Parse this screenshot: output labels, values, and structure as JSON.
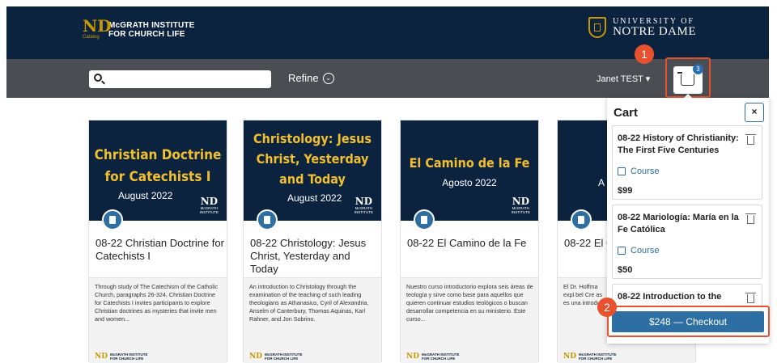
{
  "header": {
    "brand_line1": "McGRATH INSTITUTE",
    "brand_line2": "FOR CHURCH LIFE",
    "brand_catalog": "Catalog",
    "university_line1": "UNIVERSITY OF",
    "university_line2": "NOTRE DAME"
  },
  "nav": {
    "search_placeholder": "",
    "refine_label": "Refine",
    "user_label": "Janet TEST ▾",
    "cart_count": "3"
  },
  "callouts": [
    "1",
    "2"
  ],
  "cards": [
    {
      "banner_title": "Christian Doctrine for Catechists I",
      "banner_date": "August 2022",
      "title": "08-22 Christian Doctrine for Catechists I",
      "description": "Through study of The Catechism of the Catholic Church, paragraphs 26-324, Christian Doctrine for Catechists I invites participants to explore Christian doctrines as mysteries that invite men and women..."
    },
    {
      "banner_title": "Christology: Jesus Christ, Yesterday and Today",
      "banner_date": "August 2022",
      "title": "08-22 Christology: Jesus Christ, Yesterday and Today",
      "description": "An introduction to Christology through the examination of the teaching of such leading theologians as Athanasius, Cyril of Alexandria, Anselm of Canterbury, Thomas Aquinas, Karl Rahner, and Jon Sobrino."
    },
    {
      "banner_title": "El Camino de la Fe",
      "banner_date": "Agosto 2022",
      "title": "08-22 El Camino de la Fe",
      "description": "Nuestro curso introductorio explora seis áreas de teología y sirve como base para aquellos que quieren continuar estudios teológicos o buscan desarrollar competencia en su ministerio. Este curso..."
    },
    {
      "banner_title": "",
      "banner_date": "A",
      "title": "08-22 El C",
      "description": "El Dr. Hoffma expl bel Cre as es una introdu"
    }
  ],
  "logo_small": {
    "line1": "McGRATH",
    "line2": "INSTITUTE"
  },
  "card_footer": {
    "line1": "McGRATH INSTITUTE",
    "line2": "FOR CHURCH LIFE"
  },
  "cart": {
    "title": "Cart",
    "close": "×",
    "items": [
      {
        "title": "08-22 History of Christianity: The First Five Centuries",
        "type": "Course",
        "price": "$99"
      },
      {
        "title": "08-22 Mariología: María en la Fe Católica",
        "type": "Course",
        "price": "$50"
      },
      {
        "title": "08-22 Introduction to the",
        "type": "",
        "price": ""
      }
    ],
    "checkout_label": "$248 — Checkout"
  }
}
